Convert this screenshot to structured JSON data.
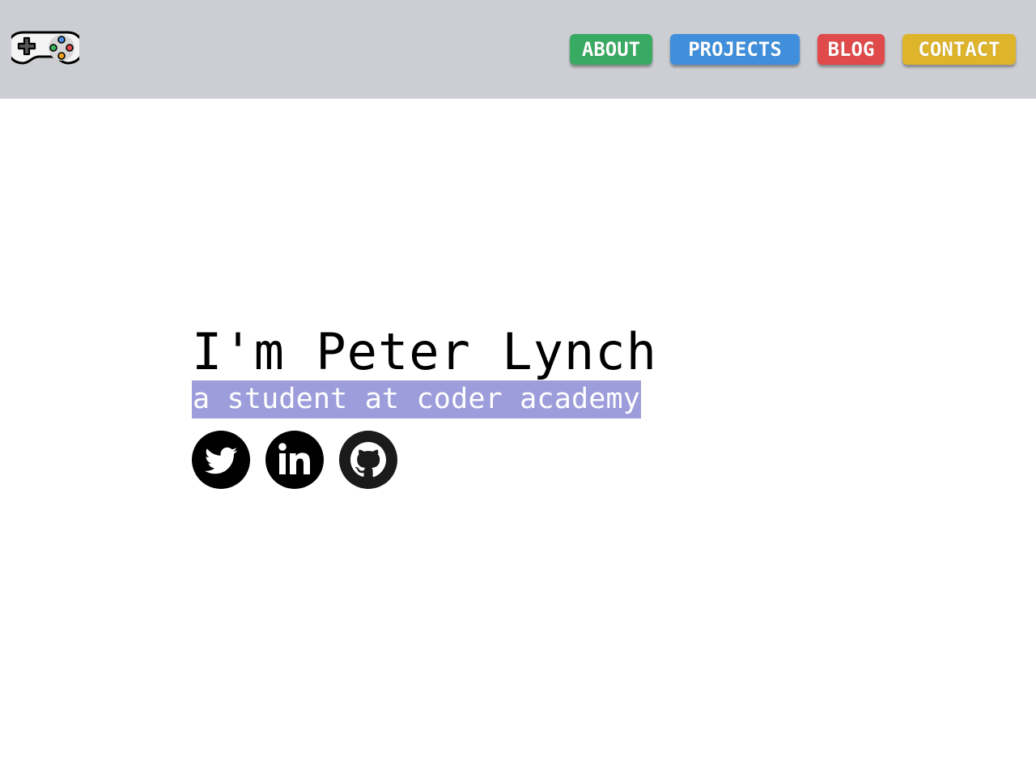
{
  "header": {
    "logo_icon": "gamepad-icon",
    "nav": [
      {
        "label": "ABOUT",
        "color": "#39aa62"
      },
      {
        "label": "PROJECTS",
        "color": "#3f8fdc"
      },
      {
        "label": "BLOG",
        "color": "#e04a4a"
      },
      {
        "label": "CONTACT",
        "color": "#deb42a"
      }
    ],
    "background": "#cdced3"
  },
  "hero": {
    "title": "I'm Peter Lynch",
    "subtitle": "a student at coder academy",
    "subtitle_highlight": "#9d9ddb"
  },
  "socials": [
    {
      "icon": "twitter-icon"
    },
    {
      "icon": "linkedin-icon"
    },
    {
      "icon": "github-icon"
    }
  ]
}
